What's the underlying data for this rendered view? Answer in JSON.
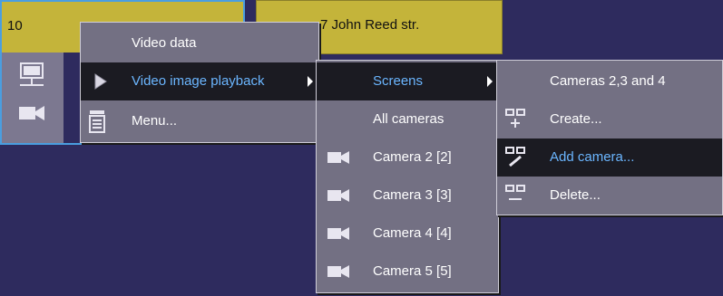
{
  "tiles": [
    {
      "title": "10"
    },
    {
      "title": "7 John Reed str."
    }
  ],
  "menu_main": {
    "items": [
      {
        "label": "Video data"
      },
      {
        "label": "Video image playback",
        "has_submenu": true,
        "highlighted": true
      },
      {
        "label": "Menu..."
      }
    ]
  },
  "menu_playback": {
    "items": [
      {
        "label": "Screens",
        "has_submenu": true,
        "highlighted": true
      },
      {
        "label": "All cameras"
      },
      {
        "label": "Camera 2 [2]",
        "icon": "camera-icon"
      },
      {
        "label": "Camera 3 [3]",
        "icon": "camera-icon"
      },
      {
        "label": "Camera 4 [4]",
        "icon": "camera-icon"
      },
      {
        "label": "Camera 5 [5]",
        "icon": "camera-icon"
      }
    ]
  },
  "menu_screens": {
    "items": [
      {
        "label": "Cameras 2,3 and 4"
      },
      {
        "label": "Create...",
        "icon": "screen-create-icon"
      },
      {
        "label": "Add camera...",
        "icon": "screen-add-camera-icon",
        "highlighted": true
      },
      {
        "label": "Delete...",
        "icon": "screen-delete-icon"
      }
    ]
  },
  "colors": {
    "background": "#2e2b5e",
    "tile": "#c4b43a",
    "menu": "#737083",
    "highlight_bg": "#1b1b22",
    "highlight_text": "#6bb6ff",
    "selection_border": "#4a9ee0"
  }
}
